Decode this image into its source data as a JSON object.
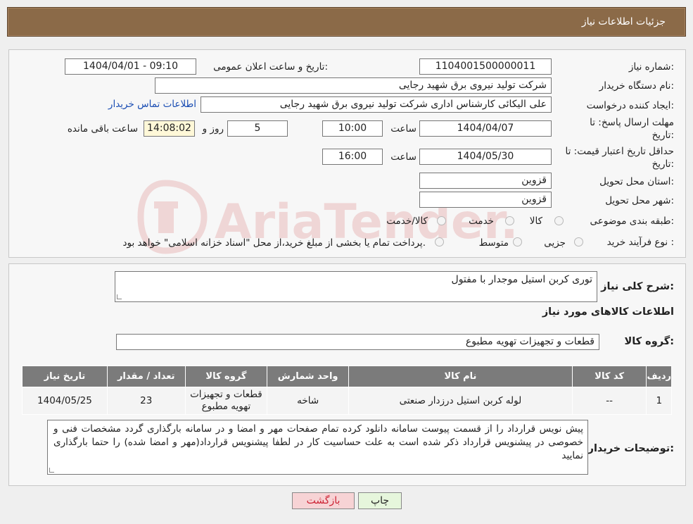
{
  "header": {
    "title": "جزئیات اطلاعات نیاز"
  },
  "form": {
    "need_number_label": "شماره نیاز:",
    "need_number": "1104001500000011",
    "announce_label": "تاریخ و ساعت اعلان عمومی:",
    "announce_value": "1404/04/01 - 09:10",
    "buyer_label": "نام دستگاه خریدار:",
    "buyer_value": "شرکت تولید نیروی برق شهید رجایی",
    "requester_label": "ایجاد کننده درخواست:",
    "requester_value": "علی الیکائی کارشناس اداری شرکت تولید نیروی برق شهید رجایی",
    "contact_link": "اطلاعات تماس خریدار",
    "deadline_label_1": "مهلت ارسال پاسخ: تا",
    "deadline_label_2": "تاریخ:",
    "deadline_date": "1404/04/07",
    "time_label": "ساعت",
    "deadline_time": "10:00",
    "days_value": "5",
    "days_label": "روز و",
    "remaining_time": "14:08:02",
    "remaining_label": "ساعت باقی مانده",
    "validity_label_1": "حداقل تاریخ اعتبار قیمت: تا",
    "validity_label_2": "تاریخ:",
    "validity_date": "1404/05/30",
    "validity_time_label": "ساعت",
    "validity_time": "16:00",
    "province_label": "استان محل تحویل:",
    "province_value": "قزوین",
    "city_label": "شهر محل تحویل:",
    "city_value": "قزوین",
    "category_label": "طبقه بندی موضوعی:",
    "category_options": [
      "کالا",
      "خدمت",
      "کالا/خدمت"
    ],
    "process_label": "نوع فرآیند خرید :",
    "process_options": [
      "جزیی",
      "متوسط"
    ],
    "process_note": "پرداخت تمام یا بخشی از مبلغ خرید،از محل \"اسناد خزانه اسلامی\" خواهد بود."
  },
  "summary": {
    "desc_label": "شرح کلی نیاز:",
    "desc_value": "توری کربن استیل موجدار با مفتول",
    "items_title": "اطلاعات کالاهای مورد نیاز",
    "group_label": "گروه کالا:",
    "group_value": "قطعات و تجهیزات تهویه مطبوع"
  },
  "table": {
    "headers": [
      "ردیف",
      "کد کالا",
      "نام کالا",
      "واحد شمارش",
      "گروه کالا",
      "تعداد / مقدار",
      "تاریخ نیاز"
    ],
    "rows": [
      [
        "1",
        "--",
        "لوله کربن استیل درزدار صنعتی",
        "شاخه",
        "قطعات و تجهیزات تهویه مطبوع",
        "23",
        "1404/05/25"
      ]
    ]
  },
  "notes": {
    "label": "توضیحات خریدار:",
    "text": "پیش نویس قرارداد را از قسمت پیوست سامانه دانلود کرده تمام صفحات مهر و امضا و در سامانه بارگذاری گردد مشخصات فنی و خصوصی در پیشنویس قرارداد ذکر شده است به علت حساسیت کار در لطفا  پیشنویس قرارداد(مهر و امضا شده) را حتما بارگذاری نمایید"
  },
  "buttons": {
    "print": "چاپ",
    "back": "بازگشت"
  },
  "watermark": {
    "text": "AriaTender.neT"
  },
  "colors": {
    "header_bg": "#8b6a48",
    "table_header_bg": "#7b7b7b",
    "print_btn": "#e6f6dc",
    "back_btn": "#f7d3d5",
    "link": "#1a4db3"
  }
}
